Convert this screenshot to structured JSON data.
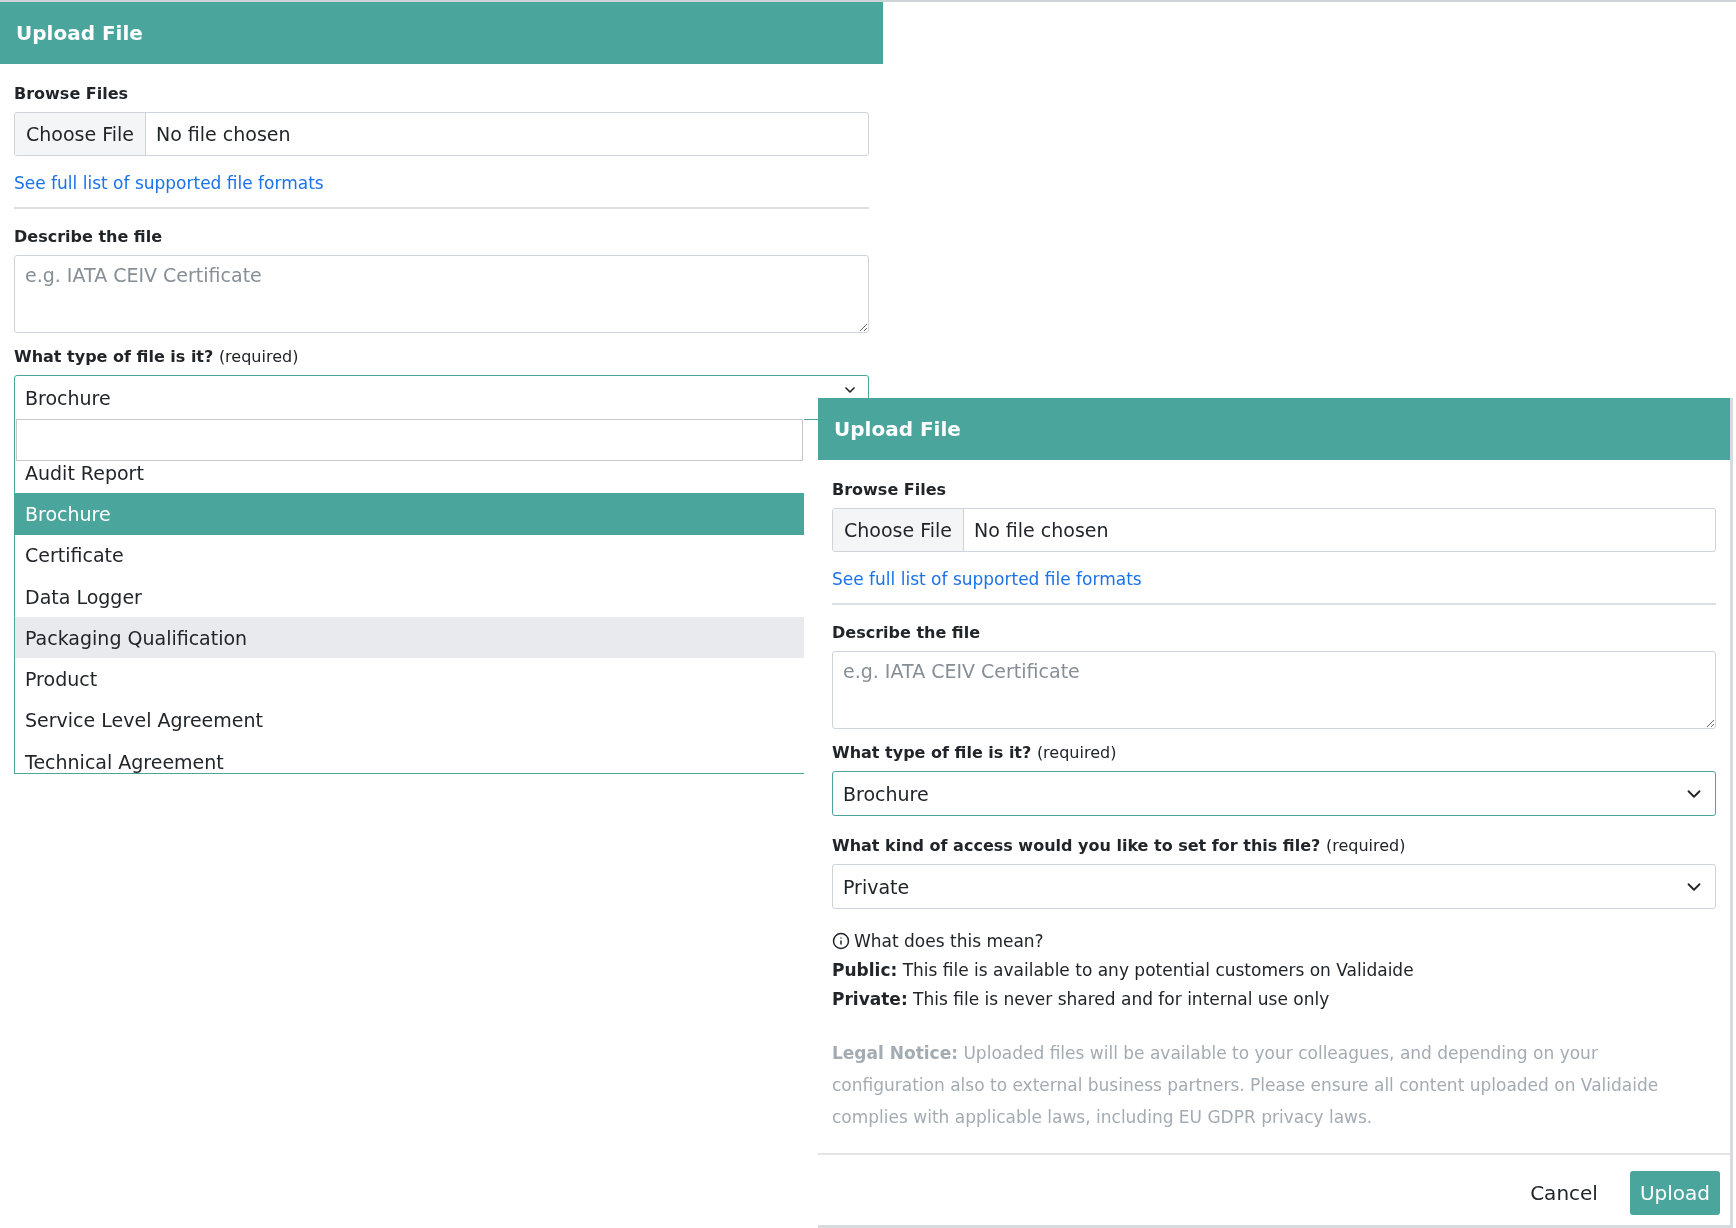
{
  "dialogs": [
    {
      "title": "Upload File",
      "browse_label": "Browse Files",
      "choose_button": "Choose File",
      "file_status": "No file chosen",
      "formats_link": "See full list of supported file formats",
      "describe_label": "Describe the file",
      "describe_placeholder": "e.g. IATA CEIV Certificate",
      "type_label": "What type of file is it?",
      "type_required": "(required)",
      "type_value": "Brochure",
      "type_open": true,
      "type_options": [
        {
          "label": "Audit Report",
          "selected": false,
          "hovered": false
        },
        {
          "label": "Brochure",
          "selected": true,
          "hovered": false
        },
        {
          "label": "Certificate",
          "selected": false,
          "hovered": false
        },
        {
          "label": "Data Logger",
          "selected": false,
          "hovered": false
        },
        {
          "label": "Packaging Qualification",
          "selected": false,
          "hovered": true
        },
        {
          "label": "Product",
          "selected": false,
          "hovered": false
        },
        {
          "label": "Service Level Agreement",
          "selected": false,
          "hovered": false
        },
        {
          "label": "Technical Agreement",
          "selected": false,
          "hovered": false
        }
      ]
    },
    {
      "title": "Upload File",
      "browse_label": "Browse Files",
      "choose_button": "Choose File",
      "file_status": "No file chosen",
      "formats_link": "See full list of supported file formats",
      "describe_label": "Describe the file",
      "describe_placeholder": "e.g. IATA CEIV Certificate",
      "type_label": "What type of file is it?",
      "type_required": "(required)",
      "type_value": "Brochure",
      "type_open": false,
      "access_label": "What kind of access would you like to set for this file?",
      "access_required": "(required)",
      "access_value": "Private",
      "help_title": "What does this mean?",
      "help_lines": [
        "**Public:** This file is available to any potential customers on Validaide",
        "**Private:** This file is never shared and for internal use only"
      ],
      "legal_notice": "**Legal Notice:** Uploaded files will be available to your colleagues, and depending on your configuration also to external business partners. Please ensure all content uploaded on Validaide complies with applicable laws, including EU GDPR privacy laws.",
      "buttons": [
        {
          "label": "Cancel",
          "kind": "secondary"
        },
        {
          "label": "Upload",
          "kind": "primary"
        }
      ]
    }
  ]
}
